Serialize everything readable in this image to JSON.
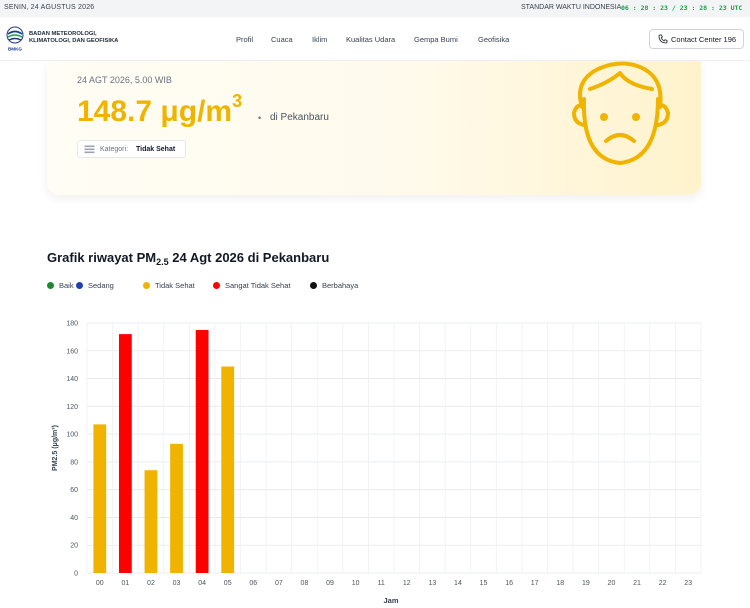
{
  "topbar": {
    "date": "SENIN, 24 AGUSTUS 2026",
    "standard_label": "STANDAR WAKTU INDONESIA",
    "clock": "06 : 28 : 23  /  23 : 28 : 23 UTC"
  },
  "header": {
    "logo_text": "BMKG",
    "brand_line1": "BADAN METEOROLOGI,",
    "brand_line2": "KLIMATOLOGI, DAN GEOFISIKA",
    "nav": [
      "Profil",
      "Cuaca",
      "Iklim",
      "Kualitas Udara",
      "Gempa Bumi",
      "Geofisika"
    ],
    "contact_label": "Contact Center 196"
  },
  "status": {
    "timestamp": "24 AGT 2026, 5.00 WIB",
    "value": "148.7 μg/m",
    "value_sup": "3",
    "separator": "•",
    "location": "di Pekanbaru",
    "category_label": "Kategori:",
    "category_value": "Tidak Sehat",
    "accent_color": "#f0b400",
    "face_icon": "sad-face-icon"
  },
  "chart_section": {
    "title_prefix": "Grafik riwayat PM",
    "title_sub": "2.5",
    "title_suffix": " 24 Agt 2026 di Pekanbaru"
  },
  "legend": [
    {
      "label": "Baik",
      "color": "#1a8a2e"
    },
    {
      "label": "Sedang",
      "color": "#1e40af"
    },
    {
      "label": "Tidak Sehat",
      "color": "#f0b400"
    },
    {
      "label": "Sangat Tidak Sehat",
      "color": "#ff0000"
    },
    {
      "label": "Berbahaya",
      "color": "#111111"
    }
  ],
  "chart_data": {
    "type": "bar",
    "categories": [
      "00",
      "01",
      "02",
      "03",
      "04",
      "05",
      "06",
      "07",
      "08",
      "09",
      "10",
      "11",
      "12",
      "13",
      "14",
      "15",
      "16",
      "17",
      "18",
      "19",
      "20",
      "21",
      "22",
      "23"
    ],
    "values": [
      107,
      172,
      74,
      93,
      175,
      148.7,
      null,
      null,
      null,
      null,
      null,
      null,
      null,
      null,
      null,
      null,
      null,
      null,
      null,
      null,
      null,
      null,
      null,
      null
    ],
    "bar_colors": [
      "#f0b400",
      "#ff0000",
      "#f0b400",
      "#f0b400",
      "#ff0000",
      "#f0b400"
    ],
    "xlabel": "Jam",
    "ylabel": "PM2.5 (μg/m³)",
    "ylim": [
      0,
      180
    ],
    "yticks": [
      0,
      20,
      40,
      60,
      80,
      100,
      120,
      140,
      160,
      180
    ],
    "grid": true
  }
}
